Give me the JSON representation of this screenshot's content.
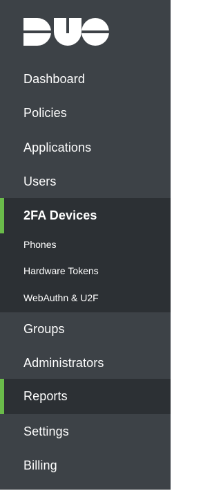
{
  "brand": {
    "logo_text": "DUO",
    "accent_color": "#6abb4a",
    "sidebar_bg": "#3d4247",
    "active_bg": "#2c3034"
  },
  "nav": {
    "dashboard": "Dashboard",
    "policies": "Policies",
    "applications": "Applications",
    "users": "Users",
    "twofa_devices": "2FA Devices",
    "groups": "Groups",
    "administrators": "Administrators",
    "reports": "Reports",
    "settings": "Settings",
    "billing": "Billing"
  },
  "twofa_sub": {
    "phones": "Phones",
    "hardware_tokens": "Hardware Tokens",
    "webauthn": "WebAuthn & U2F"
  }
}
